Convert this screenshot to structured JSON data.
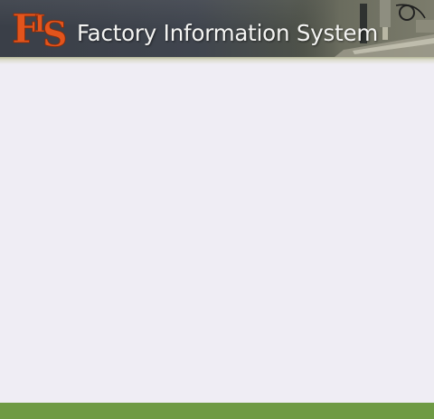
{
  "header": {
    "logo_text": "FIS",
    "title": "Factory Information System"
  },
  "colors": {
    "logo": "#e2541c",
    "header_background": "#3d424b",
    "content_background": "#efedf4",
    "footer": "#6e9a44"
  }
}
